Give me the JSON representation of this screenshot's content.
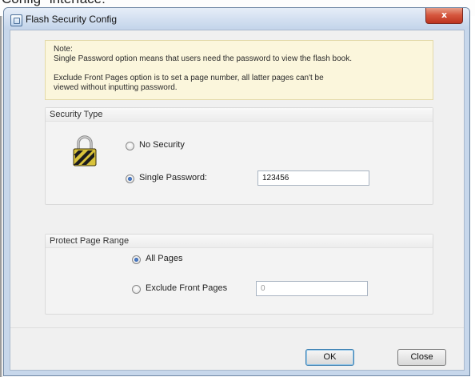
{
  "caption": "Config\" interface:",
  "window": {
    "title": "Flash Security Config",
    "close_glyph": "x"
  },
  "note": {
    "heading": "Note:",
    "line1": "Single Password option means that users need the password to view the flash book.",
    "line2": "Exclude Front Pages option is to set a page number, all latter pages can't be",
    "line3": "viewed without inputting password."
  },
  "security_type": {
    "title": "Security Type",
    "lock_icon": "padlock-icon",
    "options": [
      {
        "label": "No Security",
        "checked": false
      },
      {
        "label": "Single Password:",
        "checked": true
      }
    ],
    "password_value": "123456"
  },
  "page_range": {
    "title": "Protect Page Range",
    "options": [
      {
        "label": "All Pages",
        "checked": true
      },
      {
        "label": "Exclude Front Pages",
        "checked": false
      }
    ],
    "page_value": "0"
  },
  "buttons": {
    "ok": "OK",
    "close": "Close"
  }
}
